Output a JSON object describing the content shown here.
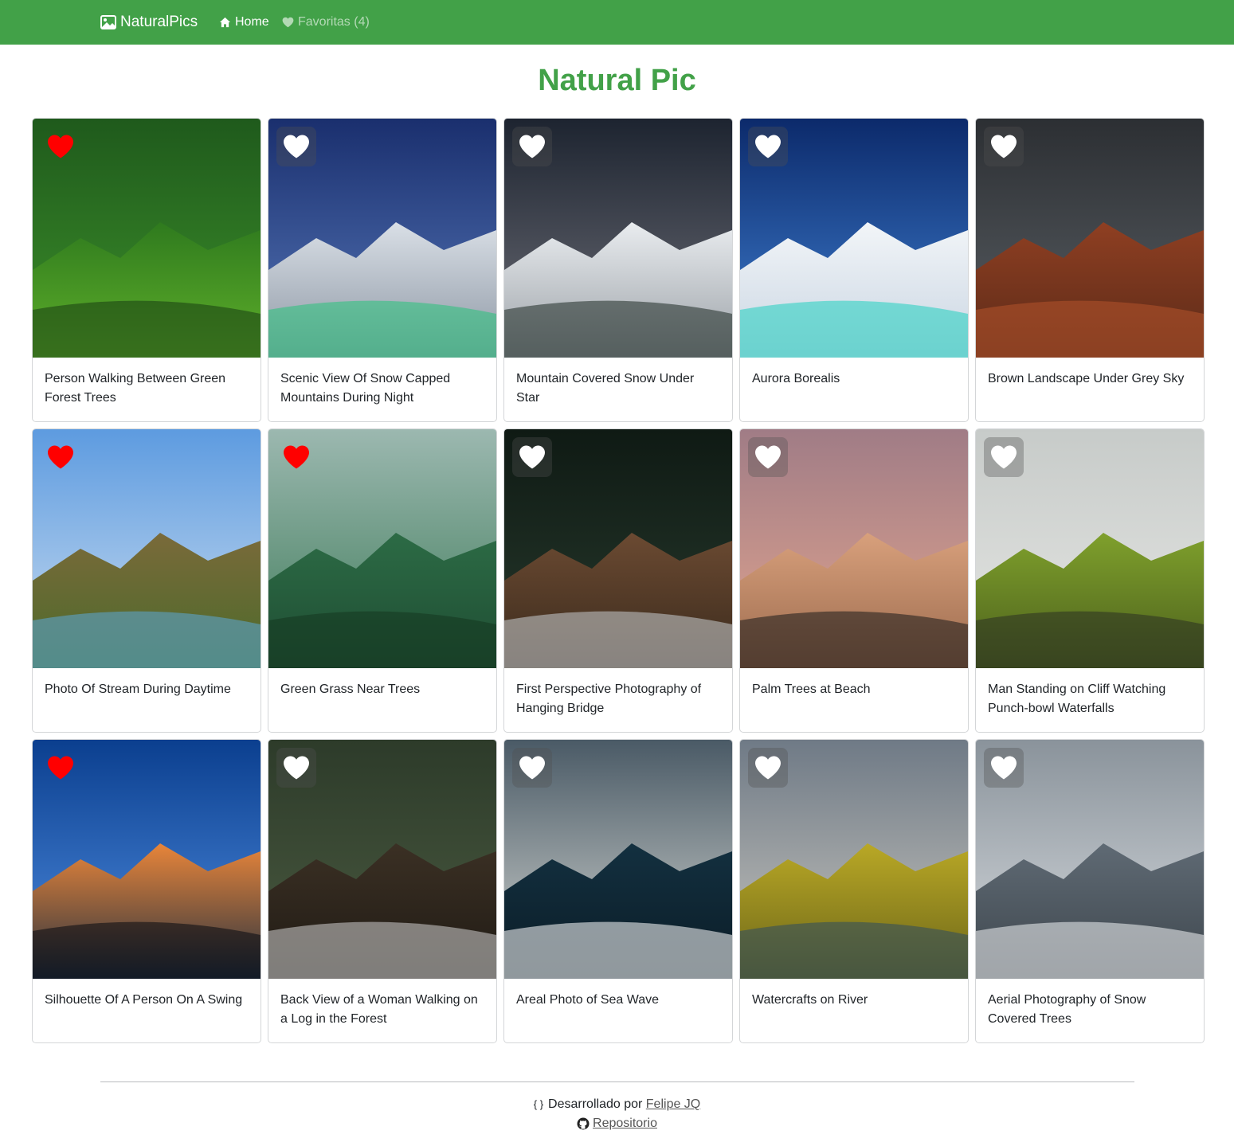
{
  "nav": {
    "brand": "NaturalPics",
    "home": "Home",
    "favorites": "Favoritas (4)"
  },
  "page": {
    "title": "Natural Pic"
  },
  "colors": {
    "primary": "#42a148",
    "heart_on": "#ff0000",
    "heart_off": "#ffffff"
  },
  "photos": [
    {
      "title": "Person Walking Between Green Forest Trees",
      "favorite": true
    },
    {
      "title": "Scenic View Of Snow Capped Mountains During Night",
      "favorite": false
    },
    {
      "title": "Mountain Covered Snow Under Star",
      "favorite": false
    },
    {
      "title": "Aurora Borealis",
      "favorite": false
    },
    {
      "title": "Brown Landscape Under Grey Sky",
      "favorite": false
    },
    {
      "title": "Photo Of Stream During Daytime",
      "favorite": true
    },
    {
      "title": "Green Grass Near Trees",
      "favorite": true
    },
    {
      "title": "First Perspective Photography of Hanging Bridge",
      "favorite": false
    },
    {
      "title": "Palm Trees at Beach",
      "favorite": false
    },
    {
      "title": "Man Standing on Cliff Watching Punch-bowl Waterfalls",
      "favorite": false
    },
    {
      "title": "Silhouette Of A Person On A Swing",
      "favorite": true
    },
    {
      "title": "Back View of a Woman Walking on a Log in the Forest",
      "favorite": false
    },
    {
      "title": "Areal Photo of Sea Wave",
      "favorite": false
    },
    {
      "title": "Watercrafts on River",
      "favorite": false
    },
    {
      "title": "Aerial Photography of Snow Covered Trees",
      "favorite": false
    }
  ],
  "footer": {
    "glyph": "{ }",
    "developed_by": "Desarrollado por",
    "author": "Felipe JQ",
    "repo": "Repositorio"
  }
}
